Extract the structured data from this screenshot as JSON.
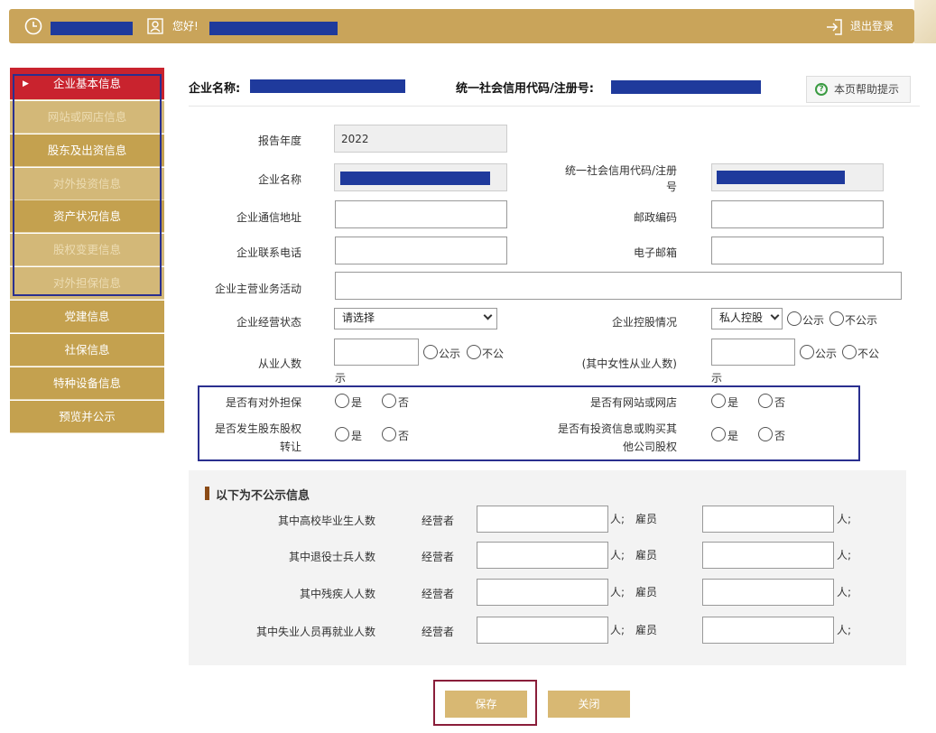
{
  "header": {
    "greeting": "您好!",
    "logout_label": "退出登录",
    "clock_icon": "clock-icon",
    "user_icon": "user-icon",
    "logout_icon": "logout-icon"
  },
  "sidebar": {
    "items": [
      {
        "label": "企业基本信息",
        "state": "active"
      },
      {
        "label": "网站或网店信息",
        "state": "muted"
      },
      {
        "label": "股东及出资信息",
        "state": "normal"
      },
      {
        "label": "对外投资信息",
        "state": "muted"
      },
      {
        "label": "资产状况信息",
        "state": "normal"
      },
      {
        "label": "股权变更信息",
        "state": "muted"
      },
      {
        "label": "对外担保信息",
        "state": "muted"
      },
      {
        "label": "党建信息",
        "state": "normal"
      },
      {
        "label": "社保信息",
        "state": "normal"
      },
      {
        "label": "特种设备信息",
        "state": "normal"
      },
      {
        "label": "预览并公示",
        "state": "normal"
      }
    ],
    "active_marker": "▶"
  },
  "info": {
    "company_label": "企业名称:",
    "credit_label": "统一社会信用代码/注册号:",
    "help_label": "本页帮助提示",
    "help_icon": "question-circle-icon"
  },
  "form": {
    "report_year_label": "报告年度",
    "report_year_value": "2022",
    "company_name_label": "企业名称",
    "credit_code_label_line1": "统一社会信用代码/注册",
    "credit_code_label_line2": "号",
    "address_label": "企业通信地址",
    "postal_label": "邮政编码",
    "phone_label": "企业联系电话",
    "email_label": "电子邮箱",
    "business_label": "企业主营业务活动",
    "status_label": "企业经营状态",
    "status_value": "请选择",
    "holding_label": "企业控股情况",
    "holding_value": "私人控股",
    "employees_label": "从业人数",
    "female_label": "(其中女性从业人数)",
    "public_label": "公示",
    "not_public_label": "不公示",
    "not_public_part1": "不公",
    "not_public_part2": "示"
  },
  "radios": {
    "guarantee_label": "是否有对外担保",
    "website_label": "是否有网站或网店",
    "equity_transfer_line1": "是否发生股东股权",
    "equity_transfer_line2": "转让",
    "investment_line1": "是否有投资信息或购买其",
    "investment_line2": "他公司股权",
    "yes": "是",
    "no": "否"
  },
  "nonpublic": {
    "title": "以下为不公示信息",
    "rows": [
      {
        "label": "其中高校毕业生人数"
      },
      {
        "label": "其中退役士兵人数"
      },
      {
        "label": "其中残疾人人数"
      },
      {
        "label": "其中失业人员再就业人数"
      }
    ],
    "operator_label": "经营者",
    "employee_label": "雇员",
    "unit_sep": "人;",
    "unit": "人;"
  },
  "buttons": {
    "save_label": "保存",
    "close_label": "关闭"
  },
  "colors": {
    "gold": "#c9a45a",
    "active_red": "#c9232e",
    "highlight_blue": "#2a2f8f",
    "save_outline": "#8a1e3a"
  }
}
